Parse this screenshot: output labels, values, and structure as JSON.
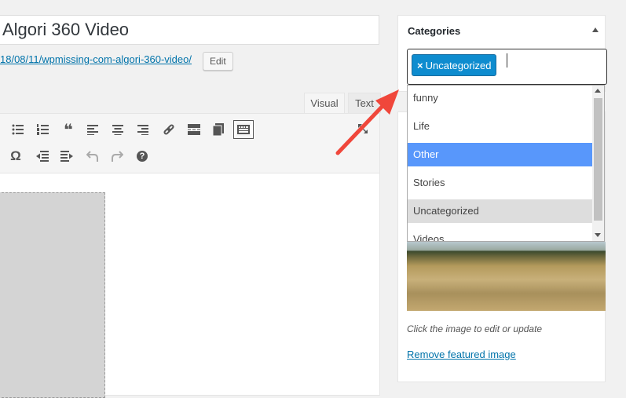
{
  "post": {
    "title": "Algori 360 Video",
    "permalink_text": "18/08/11/wpmissing-com-algori-360-video/",
    "edit_label": "Edit"
  },
  "editor": {
    "tabs": [
      {
        "label": "Visual"
      },
      {
        "label": "Text"
      }
    ],
    "toolbar_icons": [
      "bulleted-list-icon",
      "numbered-list-icon",
      "blockquote-icon",
      "align-left-icon",
      "align-center-icon",
      "align-right-icon",
      "link-icon",
      "read-more-icon",
      "distraction-free-icon",
      "toolbar-toggle-icon",
      "fullscreen-icon",
      "special-character-icon",
      "outdent-icon",
      "indent-icon",
      "undo-icon",
      "redo-icon",
      "help-icon"
    ],
    "special_char_glyph": "Ω",
    "quote_glyph": "❝",
    "help_glyph": "?"
  },
  "categories": {
    "heading": "Categories",
    "selected_chip": {
      "remove": "×",
      "label": "Uncategorized"
    },
    "options": [
      {
        "label": "funny",
        "state": "normal"
      },
      {
        "label": "Life",
        "state": "normal"
      },
      {
        "label": "Other",
        "state": "highlight"
      },
      {
        "label": "Stories",
        "state": "normal"
      },
      {
        "label": "Uncategorized",
        "state": "selected"
      },
      {
        "label": "Videos",
        "state": "normal"
      }
    ]
  },
  "featured_image": {
    "hint": "Click the image to edit or update",
    "remove_label": "Remove featured image"
  },
  "colors": {
    "accent": "#0073aa",
    "chip": "#0e8ccf",
    "highlight": "#5897fb",
    "arrow": "#f0473b"
  }
}
